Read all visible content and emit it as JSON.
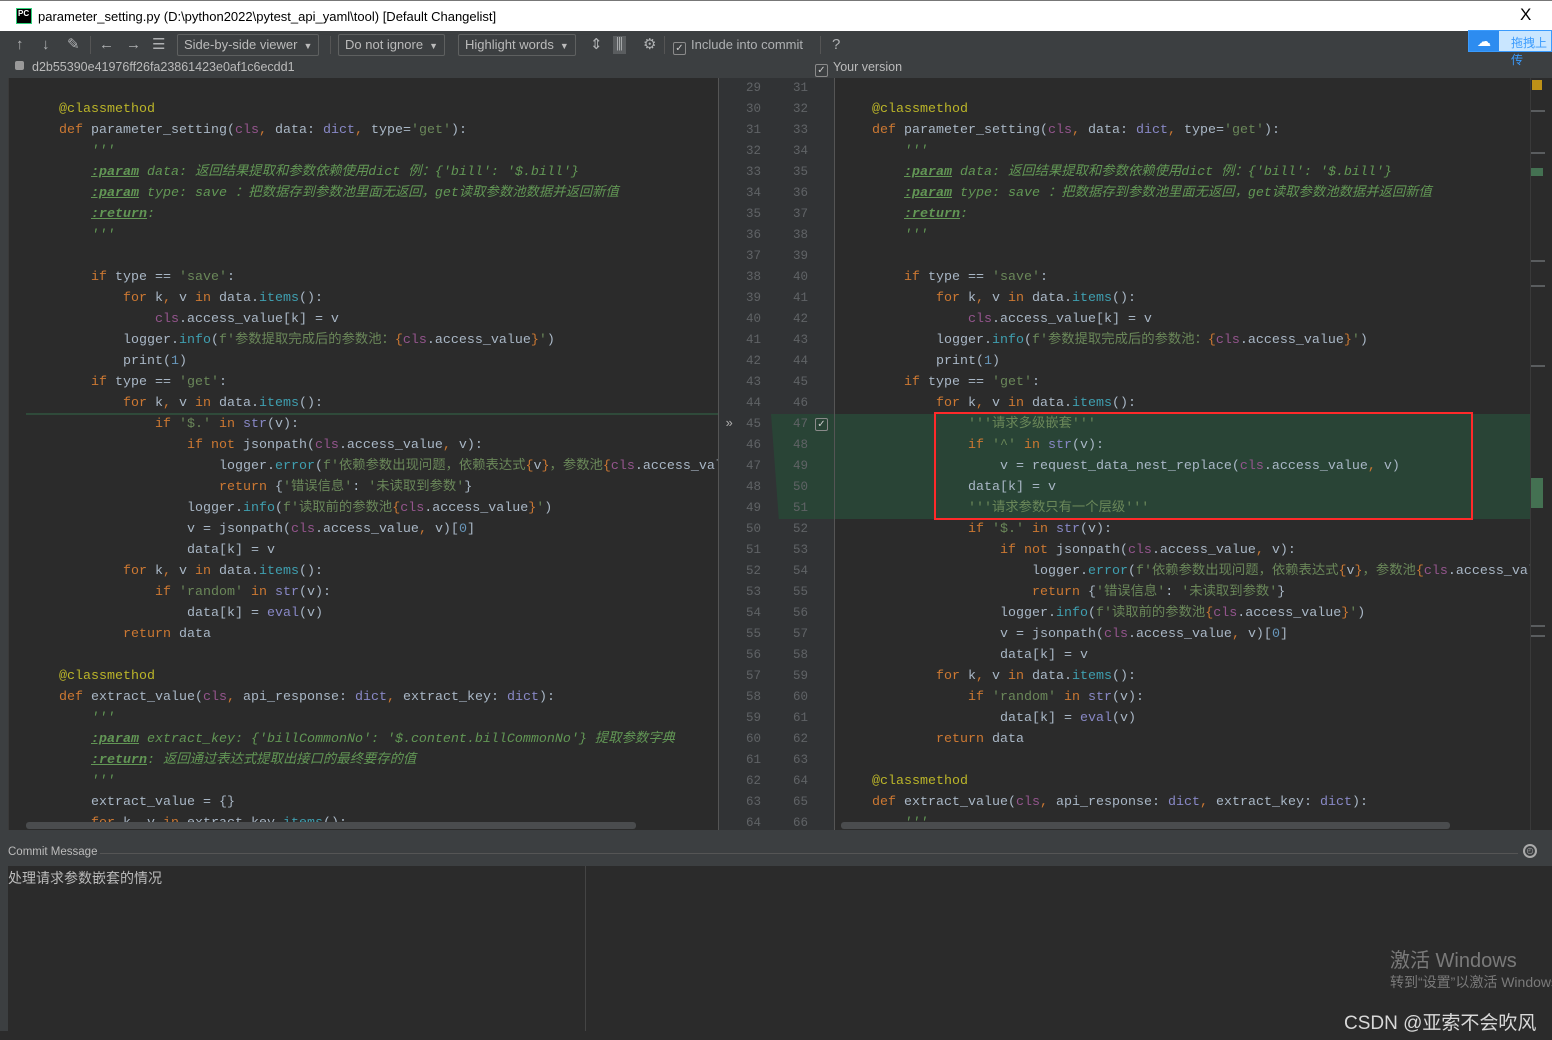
{
  "window": {
    "title": "parameter_setting.py (D:\\python2022\\pytest_api_yaml\\tool) [Default Changelist]",
    "close_label": "X",
    "app_icon": "PC"
  },
  "toolbar": {
    "viewer_mode": "Side-by-side viewer",
    "ignore_mode": "Do not ignore",
    "highlight_mode": "Highlight words",
    "include_commit": "Include into commit",
    "help": "?",
    "icons": [
      "arrow-up-icon",
      "arrow-down-icon",
      "edit-icon",
      "arrow-left-icon",
      "arrow-right-icon",
      "list-icon",
      "collapse-icon",
      "sync-scroll-icon",
      "gear-icon"
    ]
  },
  "baidu": {
    "label": "拖拽上传"
  },
  "revision": {
    "hash": "d2b55390e41976ff26fa23861423e0af1c6ecdd1",
    "your_version": "Your version"
  },
  "colors": {
    "keyword": "#cc7832",
    "string": "#6a8759",
    "docstring": "#629755",
    "self": "#94558d",
    "builtin": "#8888c6",
    "decorator": "#bbb529",
    "inserted_bg": "#294436",
    "highlight_box": "#ff2a2a"
  },
  "diff": {
    "left_start": 29,
    "right_start": 31,
    "insert_at": 16,
    "left_lines": [
      [],
      [
        [
          "d",
          "    @classmethod"
        ]
      ],
      [
        [
          "k",
          "    def "
        ],
        [
          "t",
          "parameter_setting("
        ],
        [
          "c",
          "cls"
        ],
        [
          "k",
          ", "
        ],
        [
          "t",
          "data: "
        ],
        [
          "b",
          "dict"
        ],
        [
          "k",
          ", "
        ],
        [
          "t",
          "type="
        ],
        [
          "s",
          "'get'"
        ],
        [
          "t",
          "):"
        ]
      ],
      [
        [
          "doc",
          "        '''"
        ]
      ],
      [
        [
          "doc",
          "        "
        ],
        [
          "p",
          ":param"
        ],
        [
          "doc",
          " data: 返回结果提取和参数依赖使用dict 例：{'bill': '$.bill'}"
        ]
      ],
      [
        [
          "doc",
          "        "
        ],
        [
          "p",
          ":param"
        ],
        [
          "doc",
          " type: save ：把数据存到参数池里面无返回，get读取参数池数据并返回新值"
        ]
      ],
      [
        [
          "doc",
          "        "
        ],
        [
          "p",
          ":return"
        ],
        [
          "doc",
          ":"
        ]
      ],
      [
        [
          "doc",
          "        '''"
        ]
      ],
      [],
      [
        [
          "k",
          "        if "
        ],
        [
          "t",
          "type == "
        ],
        [
          "s",
          "'save'"
        ],
        [
          "t",
          ":"
        ]
      ],
      [
        [
          "k",
          "            for "
        ],
        [
          "t",
          "k"
        ],
        [
          "k",
          ", "
        ],
        [
          "t",
          "v "
        ],
        [
          "k",
          "in "
        ],
        [
          "t",
          "data."
        ],
        [
          "m",
          "items"
        ],
        [
          "t",
          "():"
        ]
      ],
      [
        [
          "c",
          "                cls"
        ],
        [
          "t",
          ".access_value[k] = v"
        ]
      ],
      [
        [
          "t",
          "            logger."
        ],
        [
          "m",
          "info"
        ],
        [
          "t",
          "("
        ],
        [
          "s",
          "f'参数提取完成后的参数池："
        ],
        [
          "f",
          "{"
        ],
        [
          "c",
          "cls"
        ],
        [
          "t",
          ".access_value"
        ],
        [
          "f",
          "}"
        ],
        [
          "s",
          "'"
        ],
        [
          "t",
          ")"
        ]
      ],
      [
        [
          "t",
          "            print("
        ],
        [
          "n",
          "1"
        ],
        [
          "t",
          ")"
        ]
      ],
      [
        [
          "k",
          "        if "
        ],
        [
          "t",
          "type == "
        ],
        [
          "s",
          "'get'"
        ],
        [
          "t",
          ":"
        ]
      ],
      [
        [
          "k",
          "            for "
        ],
        [
          "t",
          "k"
        ],
        [
          "k",
          ", "
        ],
        [
          "t",
          "v "
        ],
        [
          "k",
          "in "
        ],
        [
          "t",
          "data."
        ],
        [
          "m",
          "items"
        ],
        [
          "t",
          "():"
        ]
      ],
      [
        [
          "k",
          "                if "
        ],
        [
          "s",
          "'$.'"
        ],
        [
          "k",
          " in "
        ],
        [
          "b",
          "str"
        ],
        [
          "t",
          "(v):"
        ]
      ],
      [
        [
          "k",
          "                    if not "
        ],
        [
          "t",
          "jsonpath("
        ],
        [
          "c",
          "cls"
        ],
        [
          "t",
          ".access_value"
        ],
        [
          "k",
          ", "
        ],
        [
          "t",
          "v):"
        ]
      ],
      [
        [
          "t",
          "                        logger."
        ],
        [
          "m",
          "error"
        ],
        [
          "t",
          "("
        ],
        [
          "s",
          "f'依赖参数出现问题，依赖表达式"
        ],
        [
          "f",
          "{"
        ],
        [
          "t",
          "v"
        ],
        [
          "f",
          "}"
        ],
        [
          "s",
          "，参数池"
        ],
        [
          "f",
          "{"
        ],
        [
          "c",
          "cls"
        ],
        [
          "t",
          ".access_val"
        ]
      ],
      [
        [
          "k",
          "                        return "
        ],
        [
          "t",
          "{"
        ],
        [
          "s",
          "'错误信息'"
        ],
        [
          "t",
          ": "
        ],
        [
          "s",
          "'未读取到参数'"
        ],
        [
          "t",
          "}"
        ]
      ],
      [
        [
          "t",
          "                    logger."
        ],
        [
          "m",
          "info"
        ],
        [
          "t",
          "("
        ],
        [
          "s",
          "f'读取前的参数池"
        ],
        [
          "f",
          "{"
        ],
        [
          "c",
          "cls"
        ],
        [
          "t",
          ".access_value"
        ],
        [
          "f",
          "}"
        ],
        [
          "s",
          "'"
        ],
        [
          "t",
          ")"
        ]
      ],
      [
        [
          "t",
          "                    v = jsonpath("
        ],
        [
          "c",
          "cls"
        ],
        [
          "t",
          ".access_value"
        ],
        [
          "k",
          ", "
        ],
        [
          "t",
          "v)["
        ],
        [
          "n",
          "0"
        ],
        [
          "t",
          "]"
        ]
      ],
      [
        [
          "t",
          "                    data[k] = v"
        ]
      ],
      [
        [
          "k",
          "            for "
        ],
        [
          "t",
          "k"
        ],
        [
          "k",
          ", "
        ],
        [
          "t",
          "v "
        ],
        [
          "k",
          "in "
        ],
        [
          "t",
          "data."
        ],
        [
          "m",
          "items"
        ],
        [
          "t",
          "():"
        ]
      ],
      [
        [
          "k",
          "                if "
        ],
        [
          "s",
          "'random'"
        ],
        [
          "k",
          " in "
        ],
        [
          "b",
          "str"
        ],
        [
          "t",
          "(v):"
        ]
      ],
      [
        [
          "t",
          "                    data[k] = "
        ],
        [
          "b",
          "eval"
        ],
        [
          "t",
          "(v)"
        ]
      ],
      [
        [
          "k",
          "            return "
        ],
        [
          "t",
          "data"
        ]
      ],
      [],
      [
        [
          "d",
          "    @classmethod"
        ]
      ],
      [
        [
          "k",
          "    def "
        ],
        [
          "t",
          "extract_value("
        ],
        [
          "c",
          "cls"
        ],
        [
          "k",
          ", "
        ],
        [
          "t",
          "api_response: "
        ],
        [
          "b",
          "dict"
        ],
        [
          "k",
          ", "
        ],
        [
          "t",
          "extract_key: "
        ],
        [
          "b",
          "dict"
        ],
        [
          "t",
          "):"
        ]
      ],
      [
        [
          "doc",
          "        '''"
        ]
      ],
      [
        [
          "doc",
          "        "
        ],
        [
          "p",
          ":param"
        ],
        [
          "doc",
          " extract_key: {'billCommonNo': '$.content.billCommonNo'} 提取参数字典"
        ]
      ],
      [
        [
          "doc",
          "        "
        ],
        [
          "p",
          ":return"
        ],
        [
          "doc",
          ": 返回通过表达式提取出接口的最终要存的值"
        ]
      ],
      [
        [
          "doc",
          "        '''"
        ]
      ],
      [
        [
          "t",
          "        extract_value = {}"
        ]
      ],
      [
        [
          "k",
          "        for "
        ],
        [
          "t",
          "k"
        ],
        [
          "k",
          ", "
        ],
        [
          "t",
          "v "
        ],
        [
          "k",
          "in "
        ],
        [
          "t",
          "extract_key."
        ],
        [
          "m",
          "items"
        ],
        [
          "t",
          "():"
        ]
      ]
    ],
    "inserted_lines": [
      [
        [
          "s",
          "                '''请求多级嵌套'''"
        ]
      ],
      [
        [
          "k",
          "                if "
        ],
        [
          "s",
          "'^'"
        ],
        [
          "k",
          " in "
        ],
        [
          "b",
          "str"
        ],
        [
          "t",
          "(v):"
        ]
      ],
      [
        [
          "t",
          "                    v = request_data_nest_replace("
        ],
        [
          "c",
          "cls"
        ],
        [
          "t",
          ".access_value"
        ],
        [
          "k",
          ", "
        ],
        [
          "t",
          "v)"
        ]
      ],
      [
        [
          "t",
          "                data[k] = v"
        ]
      ],
      [
        [
          "s",
          "                '''请求参数只有一个层级'''"
        ]
      ]
    ]
  },
  "commit": {
    "label": "Commit Message",
    "message": "处理请求参数嵌套的情况"
  },
  "watermark": {
    "activate_title": "激活 Windows",
    "activate_sub": "转到“设置”以激活 Windows。",
    "csdn": "CSDN @亚索不会吹风"
  }
}
